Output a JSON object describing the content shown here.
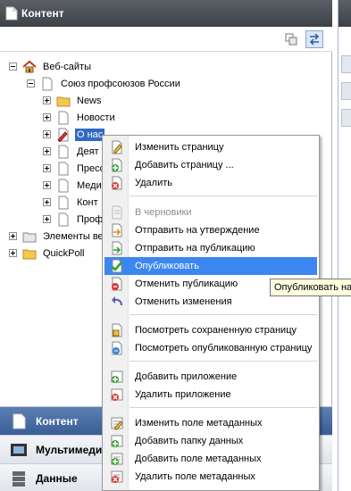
{
  "panel": {
    "title": "Контент",
    "colors": {
      "header": "#474a51",
      "selection": "#316ac5",
      "highlight": "#3b86f0"
    }
  },
  "toolbar": {
    "collapse_icon": "collapse-all-icon",
    "sync_icon": "sync-icon"
  },
  "tree": {
    "root": "Веб-сайты",
    "site": "Союз профсоюзов России",
    "children": [
      "News",
      "Новости",
      "О нас",
      "Деят",
      "Пресс",
      "Меди",
      "Конт",
      "Проф"
    ],
    "other_roots": [
      "Элементы ве",
      "QuickPoll"
    ]
  },
  "context_menu": {
    "edit_page": "Изменить страницу",
    "add_page": "Добавить страницу ...",
    "delete": "Удалить",
    "to_drafts": "В черновики",
    "send_approval": "Отправить на утверждение",
    "send_publish": "Отправить на публикацию",
    "publish": "Опубликовать",
    "unpublish": "Отменить публикацию",
    "undo_changes": "Отменить изменения",
    "view_saved": "Посмотреть сохраненную страницу",
    "view_published": "Посмотреть опубликованную страницу",
    "add_app": "Добавить приложение",
    "remove_app": "Удалить приложение",
    "edit_meta_field": "Изменить поле метаданных",
    "add_data_folder": "Добавить папку данных",
    "add_meta_field": "Добавить поле метаданных",
    "remove_meta_field": "Удалить поле метаданных"
  },
  "tooltip": "Опубликовать на",
  "bottom_nav": {
    "content": "Контент",
    "media": "Мультимеди",
    "data": "Данные"
  }
}
